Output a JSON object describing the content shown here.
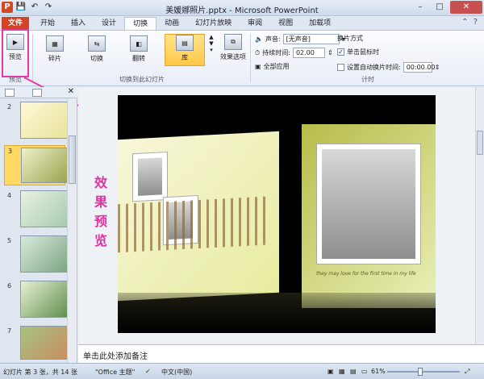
{
  "window": {
    "title": "美媛娜照片.pptx - Microsoft PowerPoint",
    "app_icon": "P",
    "controls": [
      "minimize-icon",
      "maximize-icon",
      "close-icon"
    ]
  },
  "quick_access": [
    "save-icon",
    "undo-icon",
    "redo-icon"
  ],
  "tabs": [
    {
      "label": "文件"
    },
    {
      "label": "开始"
    },
    {
      "label": "插入"
    },
    {
      "label": "设计"
    },
    {
      "label": "切换"
    },
    {
      "label": "动画"
    },
    {
      "label": "幻灯片放映"
    },
    {
      "label": "审阅"
    },
    {
      "label": "视图"
    },
    {
      "label": "加载项"
    }
  ],
  "ribbon": {
    "preview": {
      "label": "预览",
      "group": "预览"
    },
    "transitions": {
      "group": "切换到此幻灯片",
      "items": [
        "碎片",
        "切换",
        "翻转",
        "库"
      ],
      "effect_options": "效果选项"
    },
    "timing": {
      "group": "计时",
      "sound_label": "声音:",
      "sound_value": "[无声音]",
      "duration_label": "持续时间:",
      "duration_value": "02.00",
      "apply_all": "全部应用",
      "advance_title": "换片方式",
      "on_click_label": "单击鼠标时",
      "on_click_checked": true,
      "after_label": "设置自动换片时间:",
      "after_value": "00:00.00",
      "after_checked": false
    }
  },
  "thumbnails": [
    {
      "number": "2"
    },
    {
      "number": "3",
      "selected": true
    },
    {
      "number": "4"
    },
    {
      "number": "5"
    },
    {
      "number": "6"
    },
    {
      "number": "7"
    }
  ],
  "annotation": {
    "text_lines": [
      "效",
      "果",
      "预",
      "览"
    ]
  },
  "slide": {
    "caption": "they may love for the first time in my life"
  },
  "notes": {
    "placeholder": "单击此处添加备注"
  },
  "status": {
    "slide_info": "幻灯片 第 3 张，共 14 张",
    "theme": "\"Office 主题\"",
    "language": "中文(中国)",
    "zoom": "61%"
  }
}
